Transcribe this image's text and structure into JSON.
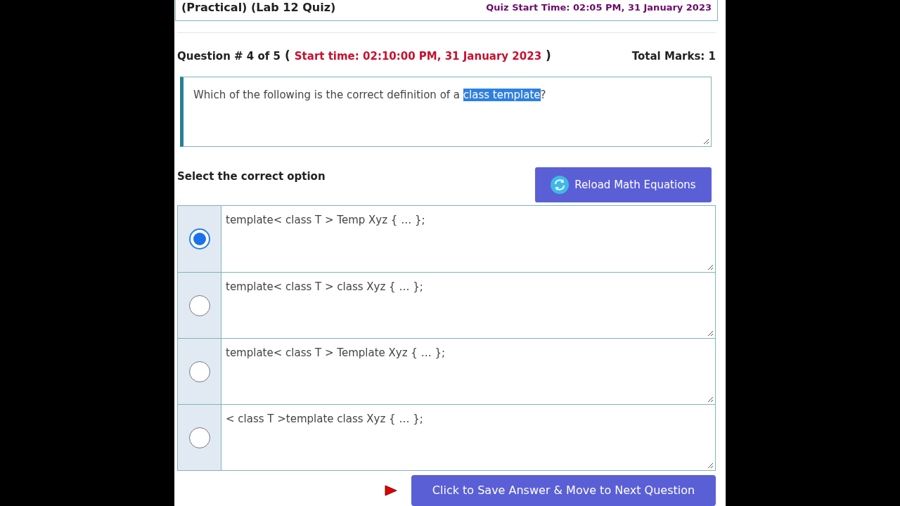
{
  "header": {
    "title": "(Practical) (Lab 12 Quiz)",
    "quiz_start": "Quiz Start Time: 02:05 PM, 31 January 2023"
  },
  "question_bar": {
    "label": "Question # 4 of 5",
    "open_paren": "(",
    "start_time": "Start time: 02:10:00 PM, 31 January 2023",
    "close_paren": ")",
    "total_marks": "Total Marks: 1"
  },
  "question": {
    "text_before": "Which of the following is the correct definition of a ",
    "selected_text": "class template",
    "text_after": "?"
  },
  "prompt": "Select the correct option",
  "reload_button": "Reload Math Equations",
  "options": [
    {
      "text": "template< class T > Temp Xyz { … };",
      "selected": true
    },
    {
      "text": "template< class T > class Xyz { … };",
      "selected": false
    },
    {
      "text": "template< class T > Template Xyz { … };",
      "selected": false
    },
    {
      "text": "< class T >template class Xyz { … };",
      "selected": false
    }
  ],
  "save_button": "Click to Save Answer & Move to Next Question"
}
